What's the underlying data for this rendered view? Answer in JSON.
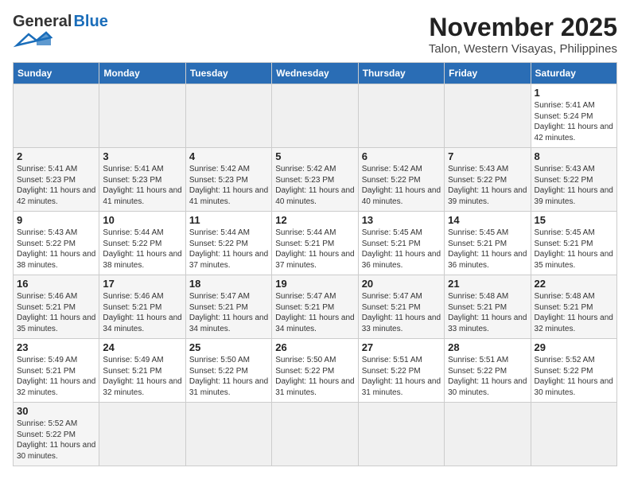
{
  "header": {
    "logo_general": "General",
    "logo_blue": "Blue",
    "title": "November 2025",
    "subtitle": "Talon, Western Visayas, Philippines"
  },
  "days_of_week": [
    "Sunday",
    "Monday",
    "Tuesday",
    "Wednesday",
    "Thursday",
    "Friday",
    "Saturday"
  ],
  "weeks": [
    [
      {
        "day": "",
        "info": ""
      },
      {
        "day": "",
        "info": ""
      },
      {
        "day": "",
        "info": ""
      },
      {
        "day": "",
        "info": ""
      },
      {
        "day": "",
        "info": ""
      },
      {
        "day": "",
        "info": ""
      },
      {
        "day": "1",
        "info": "Sunrise: 5:41 AM\nSunset: 5:24 PM\nDaylight: 11 hours and 42 minutes."
      }
    ],
    [
      {
        "day": "2",
        "info": "Sunrise: 5:41 AM\nSunset: 5:23 PM\nDaylight: 11 hours and 42 minutes."
      },
      {
        "day": "3",
        "info": "Sunrise: 5:41 AM\nSunset: 5:23 PM\nDaylight: 11 hours and 41 minutes."
      },
      {
        "day": "4",
        "info": "Sunrise: 5:42 AM\nSunset: 5:23 PM\nDaylight: 11 hours and 41 minutes."
      },
      {
        "day": "5",
        "info": "Sunrise: 5:42 AM\nSunset: 5:23 PM\nDaylight: 11 hours and 40 minutes."
      },
      {
        "day": "6",
        "info": "Sunrise: 5:42 AM\nSunset: 5:22 PM\nDaylight: 11 hours and 40 minutes."
      },
      {
        "day": "7",
        "info": "Sunrise: 5:43 AM\nSunset: 5:22 PM\nDaylight: 11 hours and 39 minutes."
      },
      {
        "day": "8",
        "info": "Sunrise: 5:43 AM\nSunset: 5:22 PM\nDaylight: 11 hours and 39 minutes."
      }
    ],
    [
      {
        "day": "9",
        "info": "Sunrise: 5:43 AM\nSunset: 5:22 PM\nDaylight: 11 hours and 38 minutes."
      },
      {
        "day": "10",
        "info": "Sunrise: 5:44 AM\nSunset: 5:22 PM\nDaylight: 11 hours and 38 minutes."
      },
      {
        "day": "11",
        "info": "Sunrise: 5:44 AM\nSunset: 5:22 PM\nDaylight: 11 hours and 37 minutes."
      },
      {
        "day": "12",
        "info": "Sunrise: 5:44 AM\nSunset: 5:21 PM\nDaylight: 11 hours and 37 minutes."
      },
      {
        "day": "13",
        "info": "Sunrise: 5:45 AM\nSunset: 5:21 PM\nDaylight: 11 hours and 36 minutes."
      },
      {
        "day": "14",
        "info": "Sunrise: 5:45 AM\nSunset: 5:21 PM\nDaylight: 11 hours and 36 minutes."
      },
      {
        "day": "15",
        "info": "Sunrise: 5:45 AM\nSunset: 5:21 PM\nDaylight: 11 hours and 35 minutes."
      }
    ],
    [
      {
        "day": "16",
        "info": "Sunrise: 5:46 AM\nSunset: 5:21 PM\nDaylight: 11 hours and 35 minutes."
      },
      {
        "day": "17",
        "info": "Sunrise: 5:46 AM\nSunset: 5:21 PM\nDaylight: 11 hours and 34 minutes."
      },
      {
        "day": "18",
        "info": "Sunrise: 5:47 AM\nSunset: 5:21 PM\nDaylight: 11 hours and 34 minutes."
      },
      {
        "day": "19",
        "info": "Sunrise: 5:47 AM\nSunset: 5:21 PM\nDaylight: 11 hours and 34 minutes."
      },
      {
        "day": "20",
        "info": "Sunrise: 5:47 AM\nSunset: 5:21 PM\nDaylight: 11 hours and 33 minutes."
      },
      {
        "day": "21",
        "info": "Sunrise: 5:48 AM\nSunset: 5:21 PM\nDaylight: 11 hours and 33 minutes."
      },
      {
        "day": "22",
        "info": "Sunrise: 5:48 AM\nSunset: 5:21 PM\nDaylight: 11 hours and 32 minutes."
      }
    ],
    [
      {
        "day": "23",
        "info": "Sunrise: 5:49 AM\nSunset: 5:21 PM\nDaylight: 11 hours and 32 minutes."
      },
      {
        "day": "24",
        "info": "Sunrise: 5:49 AM\nSunset: 5:21 PM\nDaylight: 11 hours and 32 minutes."
      },
      {
        "day": "25",
        "info": "Sunrise: 5:50 AM\nSunset: 5:22 PM\nDaylight: 11 hours and 31 minutes."
      },
      {
        "day": "26",
        "info": "Sunrise: 5:50 AM\nSunset: 5:22 PM\nDaylight: 11 hours and 31 minutes."
      },
      {
        "day": "27",
        "info": "Sunrise: 5:51 AM\nSunset: 5:22 PM\nDaylight: 11 hours and 31 minutes."
      },
      {
        "day": "28",
        "info": "Sunrise: 5:51 AM\nSunset: 5:22 PM\nDaylight: 11 hours and 30 minutes."
      },
      {
        "day": "29",
        "info": "Sunrise: 5:52 AM\nSunset: 5:22 PM\nDaylight: 11 hours and 30 minutes."
      }
    ],
    [
      {
        "day": "30",
        "info": "Sunrise: 5:52 AM\nSunset: 5:22 PM\nDaylight: 11 hours and 30 minutes."
      },
      {
        "day": "",
        "info": ""
      },
      {
        "day": "",
        "info": ""
      },
      {
        "day": "",
        "info": ""
      },
      {
        "day": "",
        "info": ""
      },
      {
        "day": "",
        "info": ""
      },
      {
        "day": "",
        "info": ""
      }
    ]
  ]
}
